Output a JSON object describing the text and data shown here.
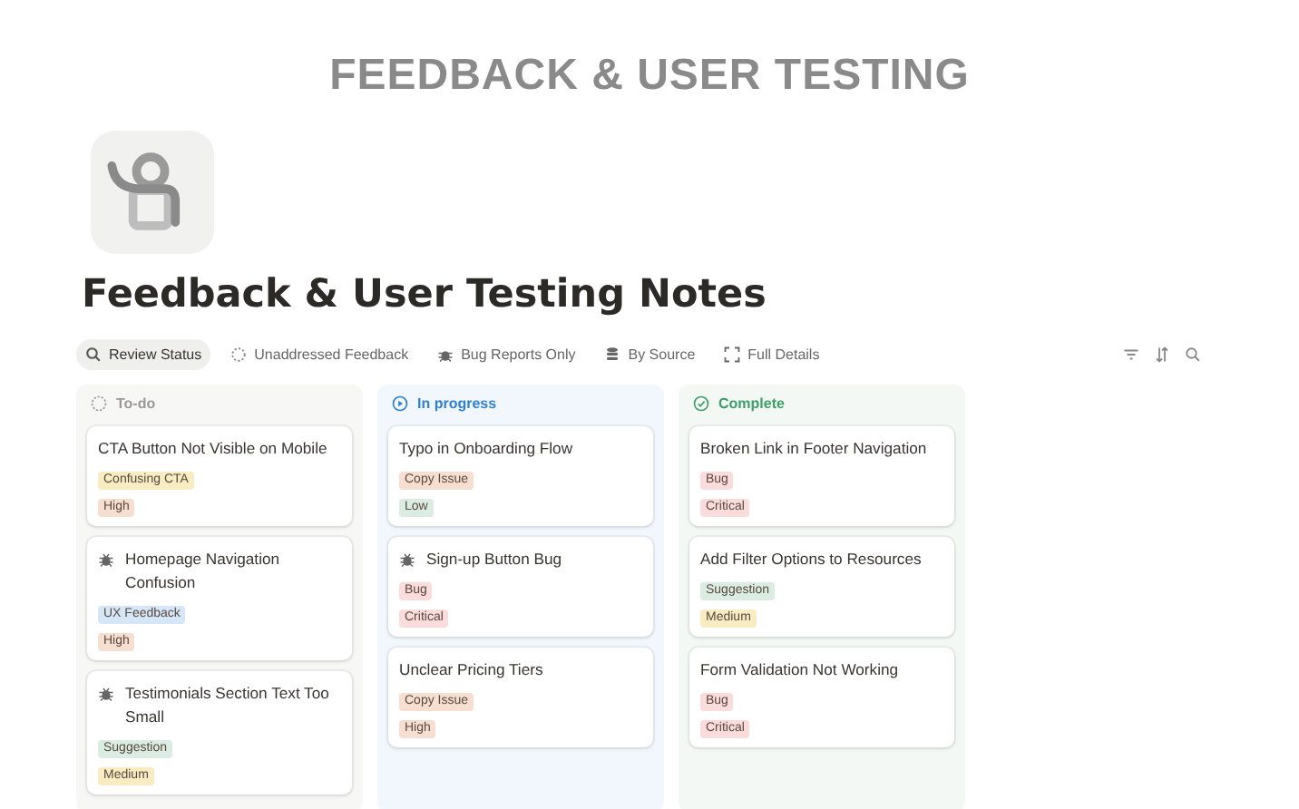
{
  "banner": {
    "title": "FEEDBACK & USER TESTING"
  },
  "page": {
    "title": "Feedback & User Testing Notes"
  },
  "views": [
    {
      "label": "Review Status",
      "selected": true
    },
    {
      "label": "Unaddressed Feedback",
      "selected": false
    },
    {
      "label": "Bug Reports Only",
      "selected": false
    },
    {
      "label": "By Source",
      "selected": false
    },
    {
      "label": "Full Details",
      "selected": false
    }
  ],
  "columns": [
    {
      "name": "To-do",
      "kind": "todo",
      "color": "#9b9a97",
      "cards": [
        {
          "title": "CTA Button Not Visible on Mobile",
          "bug": false,
          "tags": [
            {
              "label": "Confusing CTA",
              "color": "#f8ecc2"
            },
            {
              "label": "High",
              "color": "#f6dfd0"
            }
          ]
        },
        {
          "title": "Homepage Navigation Confusion",
          "bug": true,
          "tags": [
            {
              "label": "UX Feedback",
              "color": "#d5e7f7"
            },
            {
              "label": "High",
              "color": "#f6dfd0"
            }
          ]
        },
        {
          "title": "Testimonials Section Text Too Small",
          "bug": true,
          "tags": [
            {
              "label": "Suggestion",
              "color": "#dbece2"
            },
            {
              "label": "Medium",
              "color": "#f8ecc2"
            }
          ]
        }
      ]
    },
    {
      "name": "In progress",
      "kind": "progress",
      "color": "#2f80d0",
      "cards": [
        {
          "title": "Typo in Onboarding Flow",
          "bug": false,
          "tags": [
            {
              "label": "Copy Issue",
              "color": "#f6dfd0"
            },
            {
              "label": "Low",
              "color": "#dbece2"
            }
          ]
        },
        {
          "title": "Sign-up Button Bug",
          "bug": true,
          "tags": [
            {
              "label": "Bug",
              "color": "#fbdcdc"
            },
            {
              "label": "Critical",
              "color": "#fbdcdc"
            }
          ]
        },
        {
          "title": "Unclear Pricing Tiers",
          "bug": false,
          "tags": [
            {
              "label": "Copy Issue",
              "color": "#f6dfd0"
            },
            {
              "label": "High",
              "color": "#f6dfd0"
            }
          ]
        }
      ]
    },
    {
      "name": "Complete",
      "kind": "complete",
      "color": "#3f9d6a",
      "cards": [
        {
          "title": "Broken Link in Footer Navigation",
          "bug": false,
          "tags": [
            {
              "label": "Bug",
              "color": "#fbdcdc"
            },
            {
              "label": "Critical",
              "color": "#fbdcdc"
            }
          ]
        },
        {
          "title": "Add Filter Options to Resources",
          "bug": false,
          "tags": [
            {
              "label": "Suggestion",
              "color": "#dbece2"
            },
            {
              "label": "Medium",
              "color": "#f8ecc2"
            }
          ]
        },
        {
          "title": "Form Validation Not Working",
          "bug": false,
          "tags": [
            {
              "label": "Bug",
              "color": "#fbdcdc"
            },
            {
              "label": "Critical",
              "color": "#fbdcdc"
            }
          ]
        }
      ]
    }
  ]
}
